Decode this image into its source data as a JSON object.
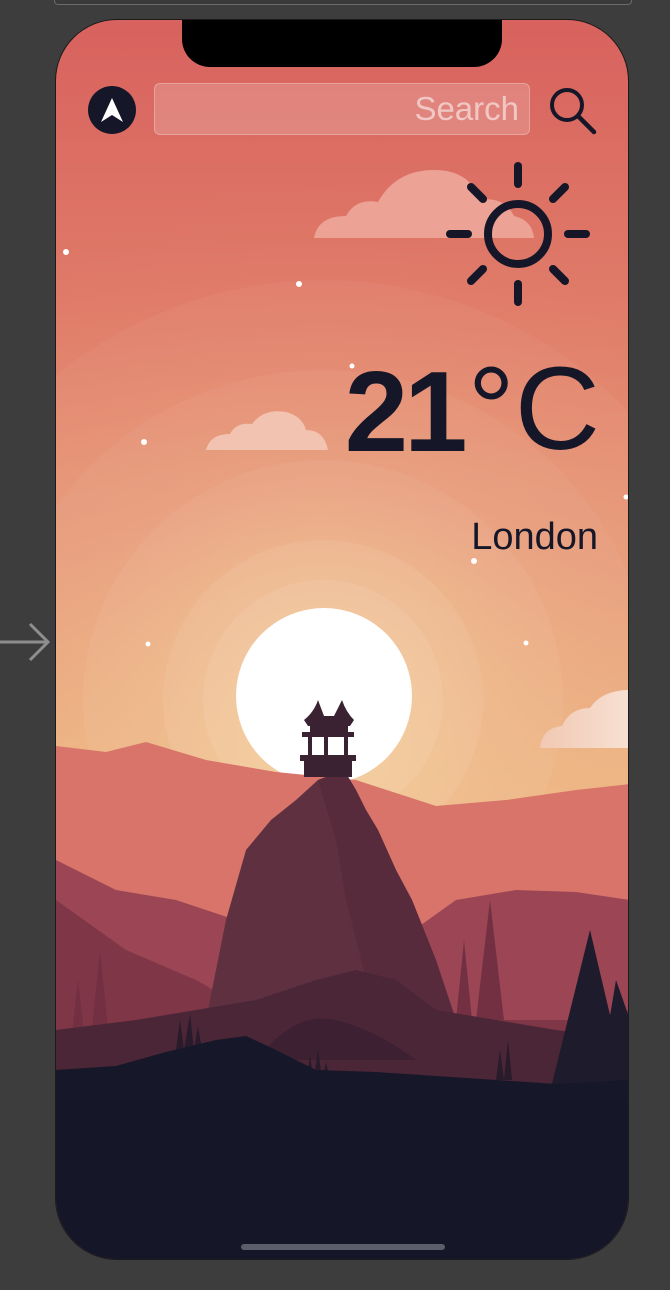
{
  "app": {
    "search": {
      "placeholder": "Search",
      "value": ""
    },
    "navigation_icon": "navigation-arrow-icon",
    "search_icon": "magnifier-icon"
  },
  "weather": {
    "condition_icon": "sun-icon",
    "temperature_value": "21",
    "temperature_unit": "°C",
    "city": "London"
  },
  "colors": {
    "sky_top": "#d9655f",
    "sky_horizon": "#f0c07a",
    "sun": "#ffffff",
    "foreground": "#151729",
    "mountain_far": "#d8766b",
    "mountain_mid": "#9a4553",
    "mountain_peak": "#5e303f"
  }
}
